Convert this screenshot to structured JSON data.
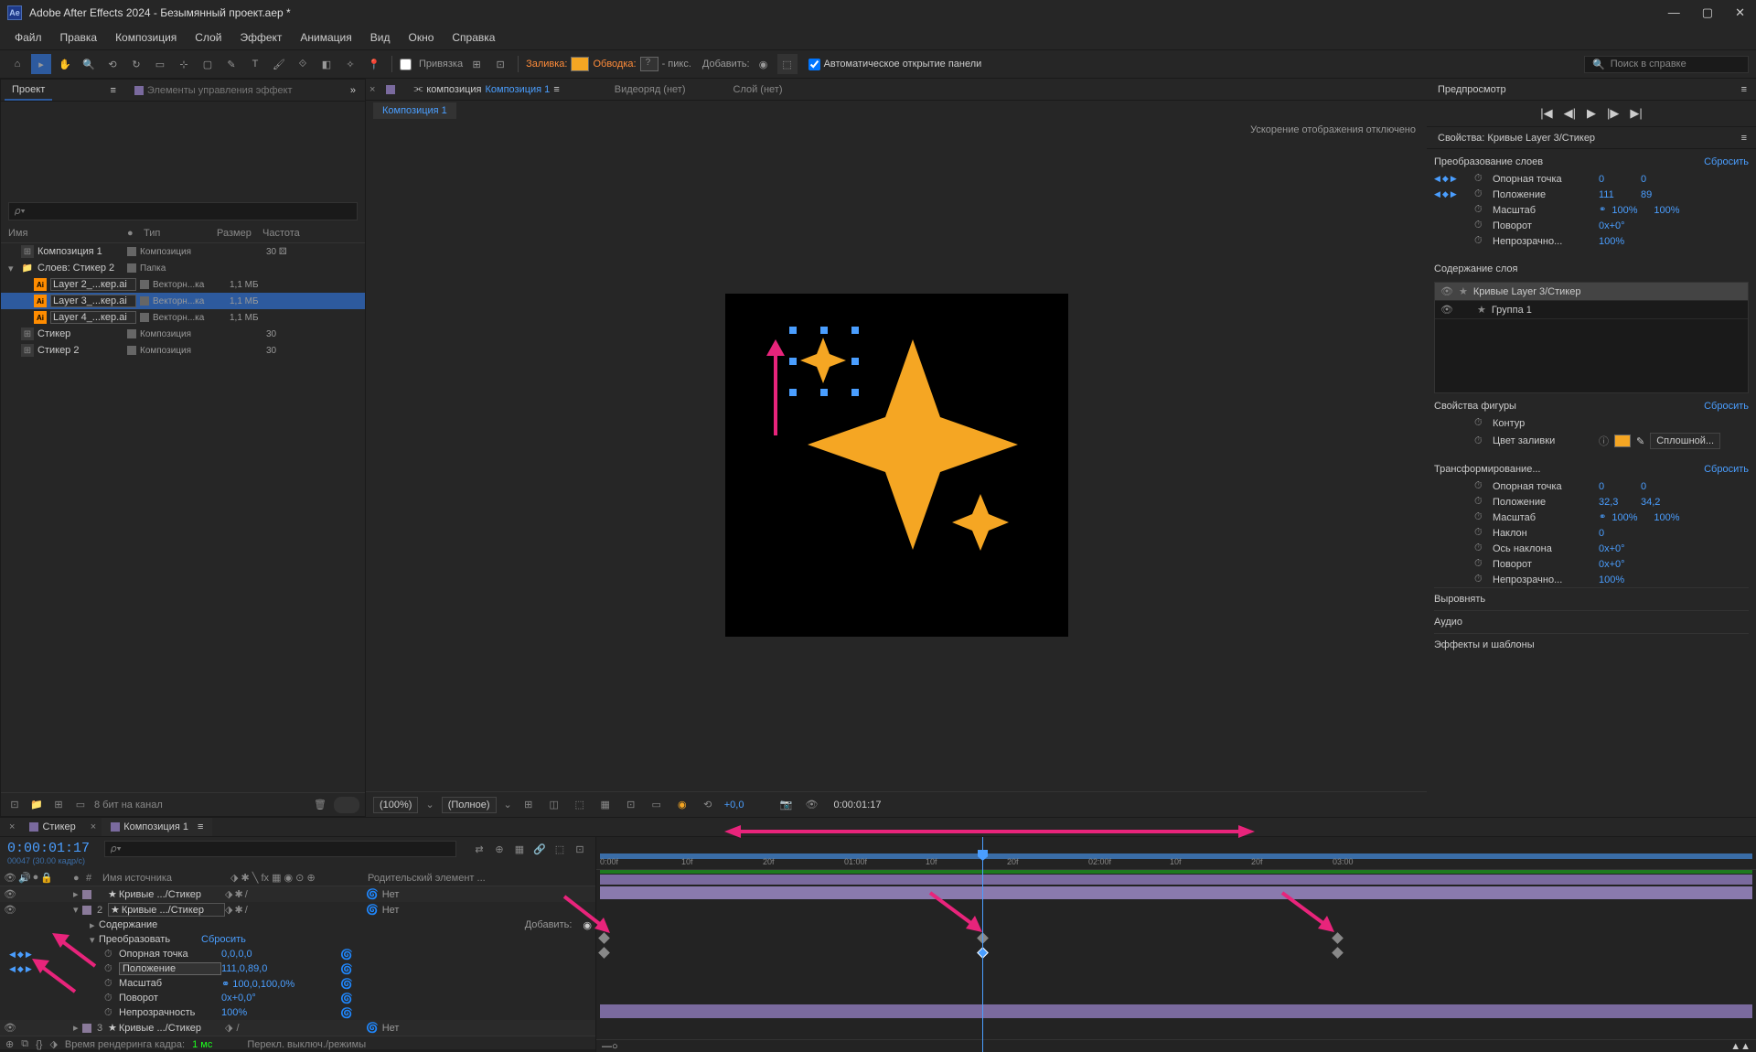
{
  "titlebar": {
    "app": "Adobe After Effects 2024 - Безымянный проект.aep *"
  },
  "menu": {
    "file": "Файл",
    "edit": "Правка",
    "composition": "Композиция",
    "layer": "Слой",
    "effect": "Эффект",
    "animation": "Анимация",
    "view": "Вид",
    "window": "Окно",
    "help": "Справка"
  },
  "toolbar": {
    "snap": "Привязка",
    "fill": "Заливка:",
    "stroke": "Обводка:",
    "stroke_px": "- пикс.",
    "add": "Добавить:",
    "auto_open": "Автоматическое открытие панели",
    "search_placeholder": "Поиск в справке"
  },
  "project": {
    "tab": "Проект",
    "elem_controls": "Элементы управления эффект",
    "search_placeholder": "𝜌▾",
    "headers": {
      "name": "Имя",
      "tag": "●",
      "type": "Тип",
      "size": "Размер",
      "freq": "Частота"
    },
    "items": [
      {
        "indent": 0,
        "twirl": "",
        "icon": "comp",
        "name": "Композиция 1",
        "type": "Композиция",
        "size": "",
        "freq": "30 ⚄",
        "selected": false,
        "boxed": false
      },
      {
        "indent": 0,
        "twirl": "▾",
        "icon": "folder",
        "name": "Слоев: Стикер 2",
        "type": "Папка",
        "size": "",
        "freq": "",
        "selected": false,
        "boxed": false
      },
      {
        "indent": 1,
        "twirl": "",
        "icon": "ai",
        "name": "Layer 2_...кер.ai",
        "type": "Векторн...ка",
        "size": "1,1 МБ",
        "freq": "",
        "selected": false,
        "boxed": true
      },
      {
        "indent": 1,
        "twirl": "",
        "icon": "ai",
        "name": "Layer 3_...кер.ai",
        "type": "Векторн...ка",
        "size": "1,1 МБ",
        "freq": "",
        "selected": true,
        "boxed": true
      },
      {
        "indent": 1,
        "twirl": "",
        "icon": "ai",
        "name": "Layer 4_...кер.ai",
        "type": "Векторн...ка",
        "size": "1,1 МБ",
        "freq": "",
        "selected": false,
        "boxed": true
      },
      {
        "indent": 0,
        "twirl": "",
        "icon": "comp",
        "name": "Стикер",
        "type": "Композиция",
        "size": "",
        "freq": "30",
        "selected": false,
        "boxed": false
      },
      {
        "indent": 0,
        "twirl": "",
        "icon": "comp",
        "name": "Стикер 2",
        "type": "Композиция",
        "size": "",
        "freq": "30",
        "selected": false,
        "boxed": false
      }
    ],
    "bpc": "8 бит на канал"
  },
  "comp": {
    "tab_prefix": "композиция",
    "tab_link": "Композиция 1",
    "viewrow": "Видеоряд  (нет)",
    "layer_none": "Слой (нет)",
    "subtab": "Композиция 1",
    "accel_off": "Ускорение отображения отключено",
    "zoom": "(100%)",
    "res": "(Полное)",
    "time": "0:00:01:17",
    "exposure": "+0,0"
  },
  "preview": {
    "tab": "Предпросмотр"
  },
  "props": {
    "title": "Свойства: Кривые Layer 3/Стикер",
    "transform_header": "Преобразование слоев",
    "reset": "Сбросить",
    "anchor": "Опорная точка",
    "anchor_x": "0",
    "anchor_y": "0",
    "position": "Положение",
    "pos_x": "111",
    "pos_y": "89",
    "scale": "Масштаб",
    "scale_x": "100%",
    "scale_y": "100%",
    "rotation": "Поворот",
    "rot_val": "0x+0°",
    "opacity": "Непрозрачно...",
    "opacity_val": "100%",
    "layer_content": "Содержание слоя",
    "layers": [
      {
        "name": "Кривые Layer 3/Стикер",
        "selected": true
      },
      {
        "name": "Группа 1",
        "selected": false
      }
    ],
    "shape_props": "Свойства фигуры",
    "contour": "Контур",
    "fill_color": "Цвет заливки",
    "fill_mode": "Сплошной...",
    "transform2": "Трансформирование...",
    "anchor2_x": "0",
    "anchor2_y": "0",
    "pos2_x": "32,3",
    "pos2_y": "34,2",
    "scale2_x": "100%",
    "scale2_y": "100%",
    "skew": "Наклон",
    "skew_val": "0",
    "skew_axis": "Ось наклона",
    "skew_axis_val": "0x+0°",
    "rot2_val": "0x+0°",
    "opacity2_val": "100%",
    "align": "Выровнять",
    "audio": "Аудио",
    "effects": "Эффекты и шаблоны"
  },
  "timeline": {
    "tab1": "Стикер",
    "tab2": "Композиция 1",
    "timecode": "0:00:01:17",
    "frame_info": "00047 (30.00 кадр/с)",
    "col_source": "Имя источника",
    "col_parent": "Родительский элемент ...",
    "ruler": [
      "0:00f",
      "10f",
      "20f",
      "01:00f",
      "10f",
      "20f",
      "02:00f",
      "10f",
      "20f",
      "03:00"
    ],
    "layers": [
      {
        "num": "",
        "name": "Кривые .../Стикер",
        "parent": "Нет",
        "boxed": false
      },
      {
        "num": "2",
        "name": "Кривые .../Стикер",
        "parent": "Нет",
        "boxed": true
      }
    ],
    "content": "Содержание",
    "add": "Добавить:",
    "transform": "Преобразовать",
    "reset": "Сбросить",
    "props": [
      {
        "name": "Опорная точка",
        "val": "0,0,0,0",
        "kf": true,
        "boxed": false
      },
      {
        "name": "Положение",
        "val": "111,0,89,0",
        "kf": true,
        "boxed": true
      },
      {
        "name": "Масштаб",
        "val": "⚭ 100,0,100,0%",
        "kf": false,
        "boxed": false
      },
      {
        "name": "Поворот",
        "val": "0x+0,0°",
        "kf": false,
        "boxed": false
      },
      {
        "name": "Непрозрачность",
        "val": "100%",
        "kf": false,
        "boxed": false
      }
    ],
    "layer3": {
      "num": "3",
      "name": "Кривые .../Стикер",
      "parent": "Нет"
    },
    "render_label": "Время рендеринга кадра:",
    "render_time": "1 мс",
    "toggle": "Перекл. выключ./режимы"
  }
}
